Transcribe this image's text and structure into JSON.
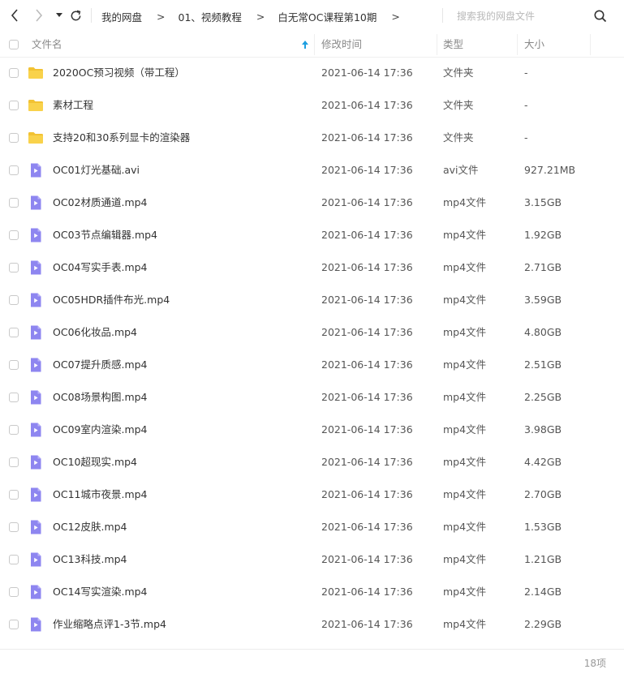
{
  "nav": {
    "back_icon": "chevron-left-icon",
    "forward_icon": "chevron-right-icon",
    "history_icon": "caret-down-icon",
    "refresh_icon": "refresh-icon"
  },
  "breadcrumb": {
    "items": [
      "我的网盘",
      "01、视频教程",
      "白无常OC课程第10期"
    ],
    "separator": ">"
  },
  "search": {
    "placeholder": "搜索我的网盘文件",
    "value": "",
    "icon": "search-icon"
  },
  "columns": {
    "name": "文件名",
    "modified": "修改时间",
    "type": "类型",
    "size": "大小",
    "sort_icon": "arrow-up-icon"
  },
  "colors": {
    "folder": "#f9d24b",
    "folder_dark": "#f2c233",
    "video": "#8e86f0",
    "sort_arrow": "#1e9fe0"
  },
  "files": [
    {
      "name": "2020OC预习视频（带工程）",
      "modified": "2021-06-14 17:36",
      "type": "文件夹",
      "size": "-",
      "icon": "folder-icon"
    },
    {
      "name": "素材工程",
      "modified": "2021-06-14 17:36",
      "type": "文件夹",
      "size": "-",
      "icon": "folder-icon"
    },
    {
      "name": "支持20和30系列显卡的渲染器",
      "modified": "2021-06-14 17:36",
      "type": "文件夹",
      "size": "-",
      "icon": "folder-icon"
    },
    {
      "name": "OC01灯光基础.avi",
      "modified": "2021-06-14 17:36",
      "type": "avi文件",
      "size": "927.21MB",
      "icon": "video-file-icon"
    },
    {
      "name": "OC02材质通道.mp4",
      "modified": "2021-06-14 17:36",
      "type": "mp4文件",
      "size": "3.15GB",
      "icon": "video-file-icon"
    },
    {
      "name": "OC03节点编辑器.mp4",
      "modified": "2021-06-14 17:36",
      "type": "mp4文件",
      "size": "1.92GB",
      "icon": "video-file-icon"
    },
    {
      "name": "OC04写实手表.mp4",
      "modified": "2021-06-14 17:36",
      "type": "mp4文件",
      "size": "2.71GB",
      "icon": "video-file-icon"
    },
    {
      "name": "OC05HDR插件布光.mp4",
      "modified": "2021-06-14 17:36",
      "type": "mp4文件",
      "size": "3.59GB",
      "icon": "video-file-icon"
    },
    {
      "name": "OC06化妆品.mp4",
      "modified": "2021-06-14 17:36",
      "type": "mp4文件",
      "size": "4.80GB",
      "icon": "video-file-icon"
    },
    {
      "name": "OC07提升质感.mp4",
      "modified": "2021-06-14 17:36",
      "type": "mp4文件",
      "size": "2.51GB",
      "icon": "video-file-icon"
    },
    {
      "name": "OC08场景构图.mp4",
      "modified": "2021-06-14 17:36",
      "type": "mp4文件",
      "size": "2.25GB",
      "icon": "video-file-icon"
    },
    {
      "name": "OC09室内渲染.mp4",
      "modified": "2021-06-14 17:36",
      "type": "mp4文件",
      "size": "3.98GB",
      "icon": "video-file-icon"
    },
    {
      "name": "OC10超现实.mp4",
      "modified": "2021-06-14 17:36",
      "type": "mp4文件",
      "size": "4.42GB",
      "icon": "video-file-icon"
    },
    {
      "name": "OC11城市夜景.mp4",
      "modified": "2021-06-14 17:36",
      "type": "mp4文件",
      "size": "2.70GB",
      "icon": "video-file-icon"
    },
    {
      "name": "OC12皮肤.mp4",
      "modified": "2021-06-14 17:36",
      "type": "mp4文件",
      "size": "1.53GB",
      "icon": "video-file-icon"
    },
    {
      "name": "OC13科技.mp4",
      "modified": "2021-06-14 17:36",
      "type": "mp4文件",
      "size": "1.21GB",
      "icon": "video-file-icon"
    },
    {
      "name": "OC14写实渲染.mp4",
      "modified": "2021-06-14 17:36",
      "type": "mp4文件",
      "size": "2.14GB",
      "icon": "video-file-icon"
    },
    {
      "name": "作业缩略点评1-3节.mp4",
      "modified": "2021-06-14 17:36",
      "type": "mp4文件",
      "size": "2.29GB",
      "icon": "video-file-icon"
    }
  ],
  "footer": {
    "item_count": "18项"
  }
}
